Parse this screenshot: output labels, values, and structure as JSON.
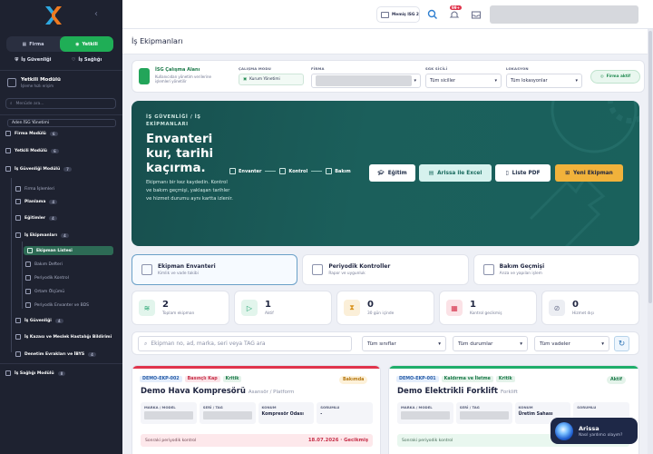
{
  "sidebar": {
    "segment": {
      "firma_label": "Firma",
      "yetkili_label": "Yetkili"
    },
    "sub_segment": {
      "is_guvenligi_label": "İş Güvenliği",
      "is_sagligi_label": "İş Sağlığı"
    },
    "module": {
      "title": "Yetkili Modülü",
      "subtitle": "İşleme hızlı erişim"
    },
    "search_placeholder": "Menüde ara...",
    "items": [
      {
        "label": "Aden İSG Yönetimi"
      },
      {
        "label": "Firma Modülü",
        "badge": "6"
      },
      {
        "label": "Yetkili Modülü",
        "badge": "6"
      },
      {
        "label": "İş Güvenliği Modülü",
        "badge": "7"
      },
      {
        "label": "Firma İşlemleri"
      },
      {
        "label": "Planlama",
        "badge": "4"
      },
      {
        "label": "Eğitimler",
        "badge": "4"
      },
      {
        "label": "İş Ekipmanları",
        "badge": "4"
      },
      {
        "label": "Ekipman Listesi"
      },
      {
        "label": "Bakım Defteri"
      },
      {
        "label": "Periyodik Kontrol"
      },
      {
        "label": "Ortam Ölçümü"
      },
      {
        "label": "Periyodik Envanter ve BDS"
      },
      {
        "label": "İş Güvenliği",
        "badge": "4"
      },
      {
        "label": "İş Kazası ve Meslek Hastalığı Bildirimi"
      },
      {
        "label": "Denetim Evrakları ve İBYS",
        "badge": "4"
      },
      {
        "label": "İş Sağlığı Modülü",
        "badge": "8"
      }
    ]
  },
  "topbar": {
    "user_label": "Memiş ISG 2",
    "notif_count": "99+"
  },
  "page": {
    "title": "İş Ekipmanları"
  },
  "filterbar": {
    "working_area_title": "İSG Çalışma Alanı",
    "working_area_desc": "Kullanıcıdan yönetim verilerine işlemleri yönetilir",
    "mode_label": "ÇALIŞMA MODU",
    "mode_value": "Kurum Yönetimi",
    "firma_label": "FİRMA",
    "sicil_label": "SGK SİCİLİ",
    "sicil_value": "Tüm siciller",
    "lokasyon_label": "LOKASYON",
    "lokasyon_value": "Tüm lokasyonlar",
    "firma_aktif": "Firma aktif"
  },
  "hero": {
    "kicker": "İŞ GÜVENLİĞİ / İŞ EKİPMANLARI",
    "title": "Envanteri kur, tarihi kaçırma.",
    "desc": "Ekipmanı bir kez kaydedin. Kontrol ve bakım geçmişi, yaklaşan tarihler ve hizmet durumu aynı kartta izlenir.",
    "steps": [
      "Envanter",
      "Kontrol",
      "Bakım"
    ],
    "buttons": {
      "egitim": "Eğitim",
      "excel": "Arissa ile Excel",
      "pdf": "Liste PDF",
      "yeni": "Yeni Ekipman"
    }
  },
  "tabs": [
    {
      "title": "Ekipman Envanteri",
      "sub": "Kimlik ve vade takibi"
    },
    {
      "title": "Periyodik Kontroller",
      "sub": "Rapor ve uygunluk"
    },
    {
      "title": "Bakım Geçmişi",
      "sub": "Arıza ve yapılan işlem"
    }
  ],
  "stats": [
    {
      "value": "2",
      "label": "Toplam ekipman",
      "color": "#1aa06a"
    },
    {
      "value": "1",
      "label": "Aktif",
      "color": "#1aa06a"
    },
    {
      "value": "0",
      "label": "30 gün içinde",
      "color": "#d9921c"
    },
    {
      "value": "1",
      "label": "Kontrol gecikmiş",
      "color": "#d6334c"
    },
    {
      "value": "0",
      "label": "Hizmet dışı",
      "color": "#6f7590"
    }
  ],
  "search": {
    "placeholder": "Ekipman no, ad, marka, seri veya TAG ara",
    "sinif": "Tüm sınıflar",
    "durum": "Tüm durumlar",
    "vade": "Tüm vadeler"
  },
  "cards": [
    {
      "code": "DEMO-EKP-002",
      "cat": "Basınçlı Kap",
      "level": "Kritik",
      "status": "Bakımda",
      "title": "Demo Hava Kompresörü",
      "type": "Asansör / Platform",
      "marka_label": "MARKA / MODEL",
      "seri_label": "SERİ / TAG",
      "konum_label": "KONUM",
      "sorumlu_label": "SORUMLU",
      "konum": "Kompresör Odası",
      "sorumlu": "-",
      "foot_label": "Sonraki periyodik kontrol",
      "foot_value": "18.07.2026 · Gecikmiş"
    },
    {
      "code": "DEMO-EKP-001",
      "cat": "Kaldırma ve İletme",
      "level": "Kritik",
      "status": "Aktif",
      "title": "Demo Elektrikli Forklift",
      "type": "Forklift",
      "marka_label": "MARKA / MODEL",
      "seri_label": "SERİ / TAG",
      "konum_label": "KONUM",
      "sorumlu_label": "SORUMLU",
      "konum": "Üretim Sahası",
      "sorumlu": "",
      "foot_label": "Sonraki periyodik kontrol",
      "foot_value": ""
    }
  ],
  "assistant": {
    "name": "Arissa",
    "sub": "Nasıl yardımcı olayım?"
  }
}
